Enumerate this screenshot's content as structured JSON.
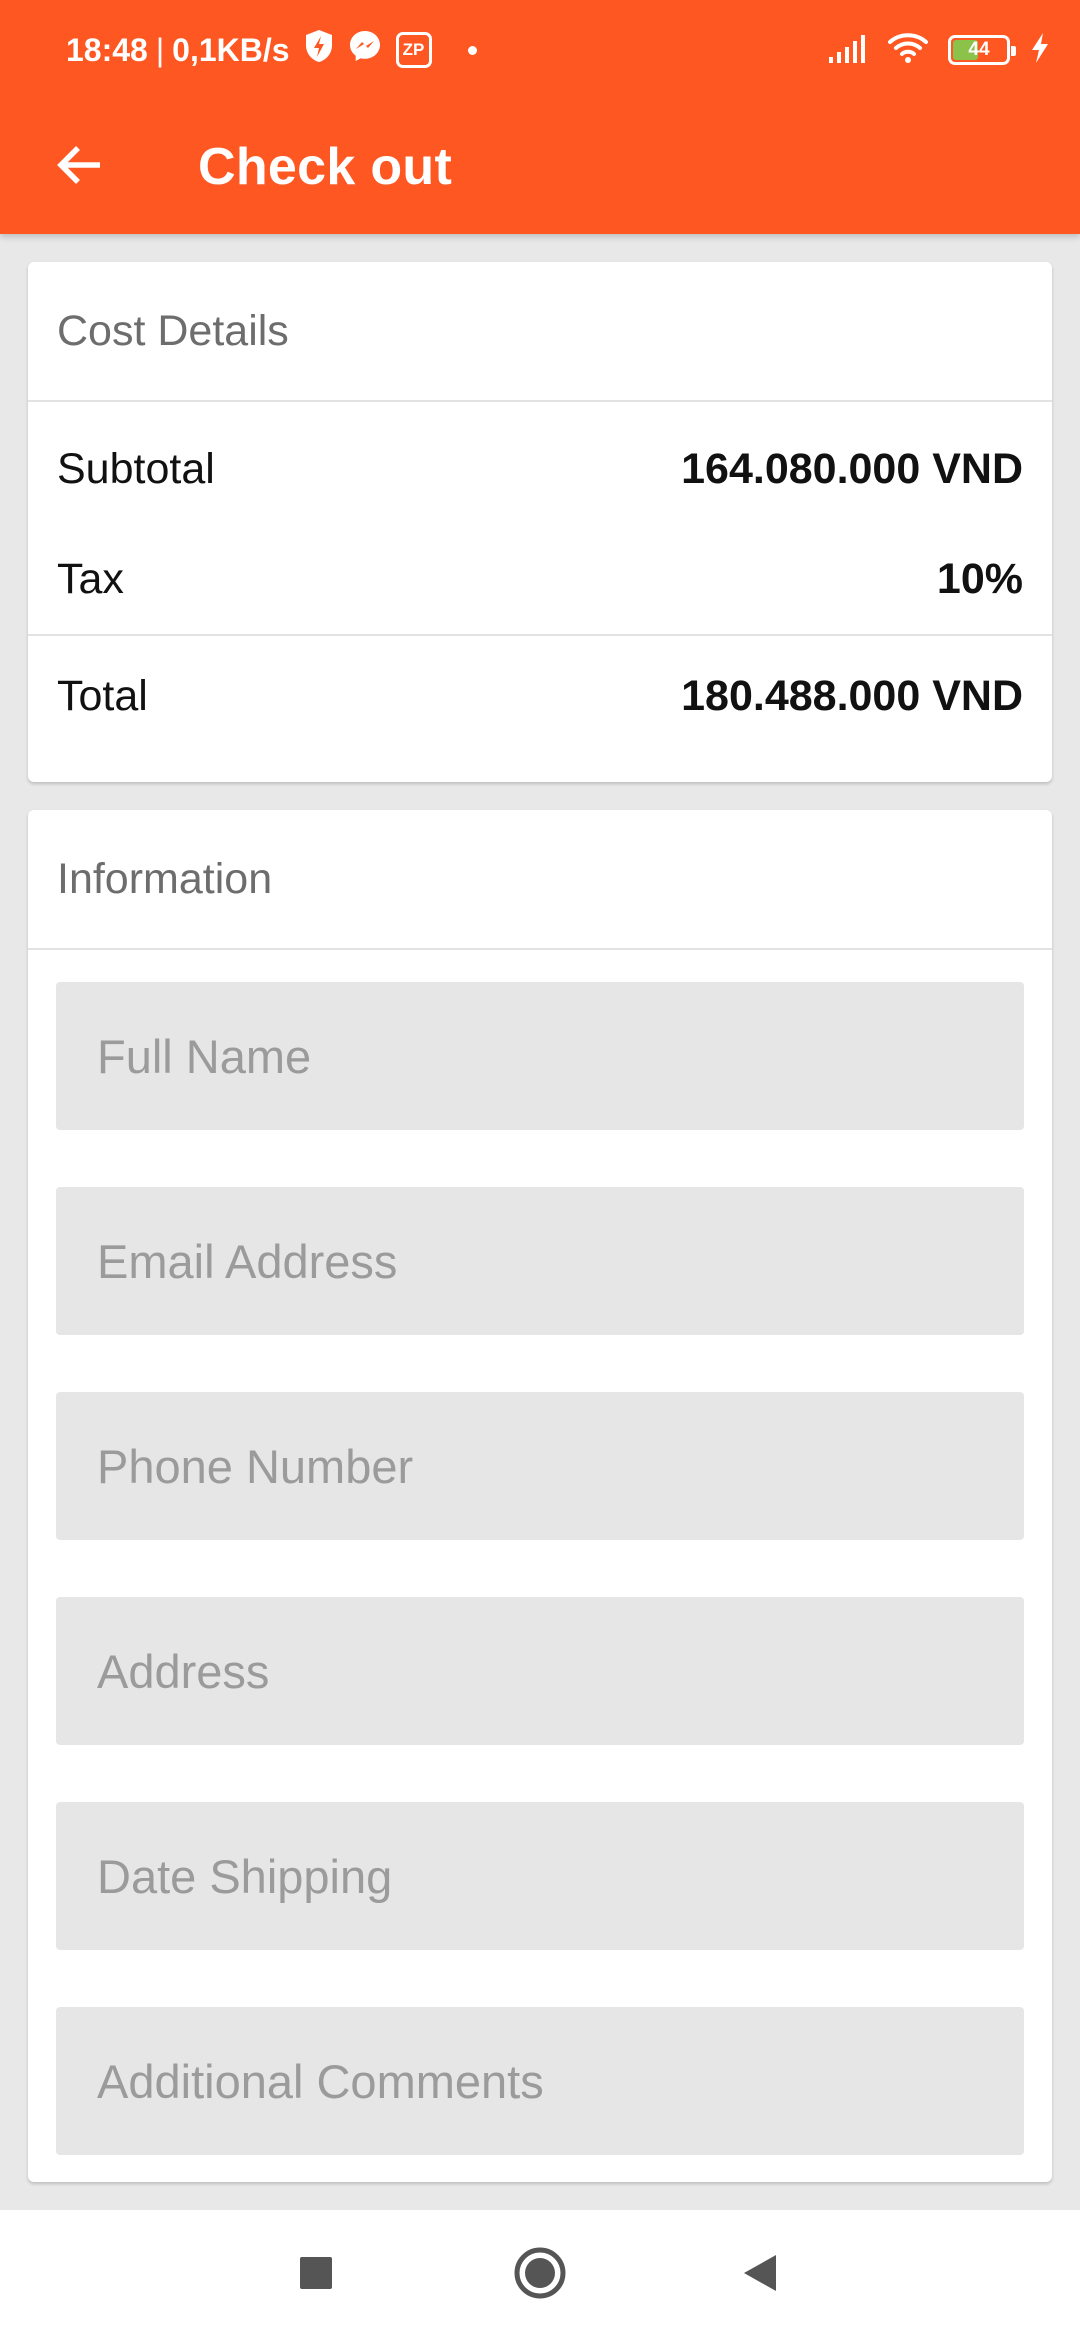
{
  "status_bar": {
    "time": "18:48",
    "separator": "|",
    "speed": "0,1KB/s",
    "zp_label": "ZP",
    "battery_percent": "44",
    "icons": [
      "shield-bolt-icon",
      "messenger-icon",
      "zp-icon",
      "signal-icon",
      "wifi-icon",
      "battery-icon",
      "charging-icon"
    ]
  },
  "header": {
    "title": "Check out",
    "back_icon": "arrow-left-icon"
  },
  "cost_details": {
    "heading": "Cost Details",
    "rows": [
      {
        "label": "Subtotal",
        "value": "164.080.000 VND"
      },
      {
        "label": "Tax",
        "value": "10%"
      },
      {
        "label": "Total",
        "value": "180.488.000 VND"
      }
    ]
  },
  "information": {
    "heading": "Information",
    "fields": [
      {
        "placeholder": "Full Name",
        "value": ""
      },
      {
        "placeholder": "Email Address",
        "value": ""
      },
      {
        "placeholder": "Phone Number",
        "value": ""
      },
      {
        "placeholder": "Address",
        "value": ""
      },
      {
        "placeholder": "Date Shipping",
        "value": ""
      },
      {
        "placeholder": "Additional Comments",
        "value": ""
      }
    ]
  },
  "navigation_bar": {
    "icons": [
      "recents-square-icon",
      "home-circle-icon",
      "back-triangle-icon"
    ]
  },
  "colors": {
    "accent": "#ff5722",
    "background": "#e8e8e8",
    "field_background": "#e6e6e6",
    "battery_fill": "#8bc34a"
  }
}
